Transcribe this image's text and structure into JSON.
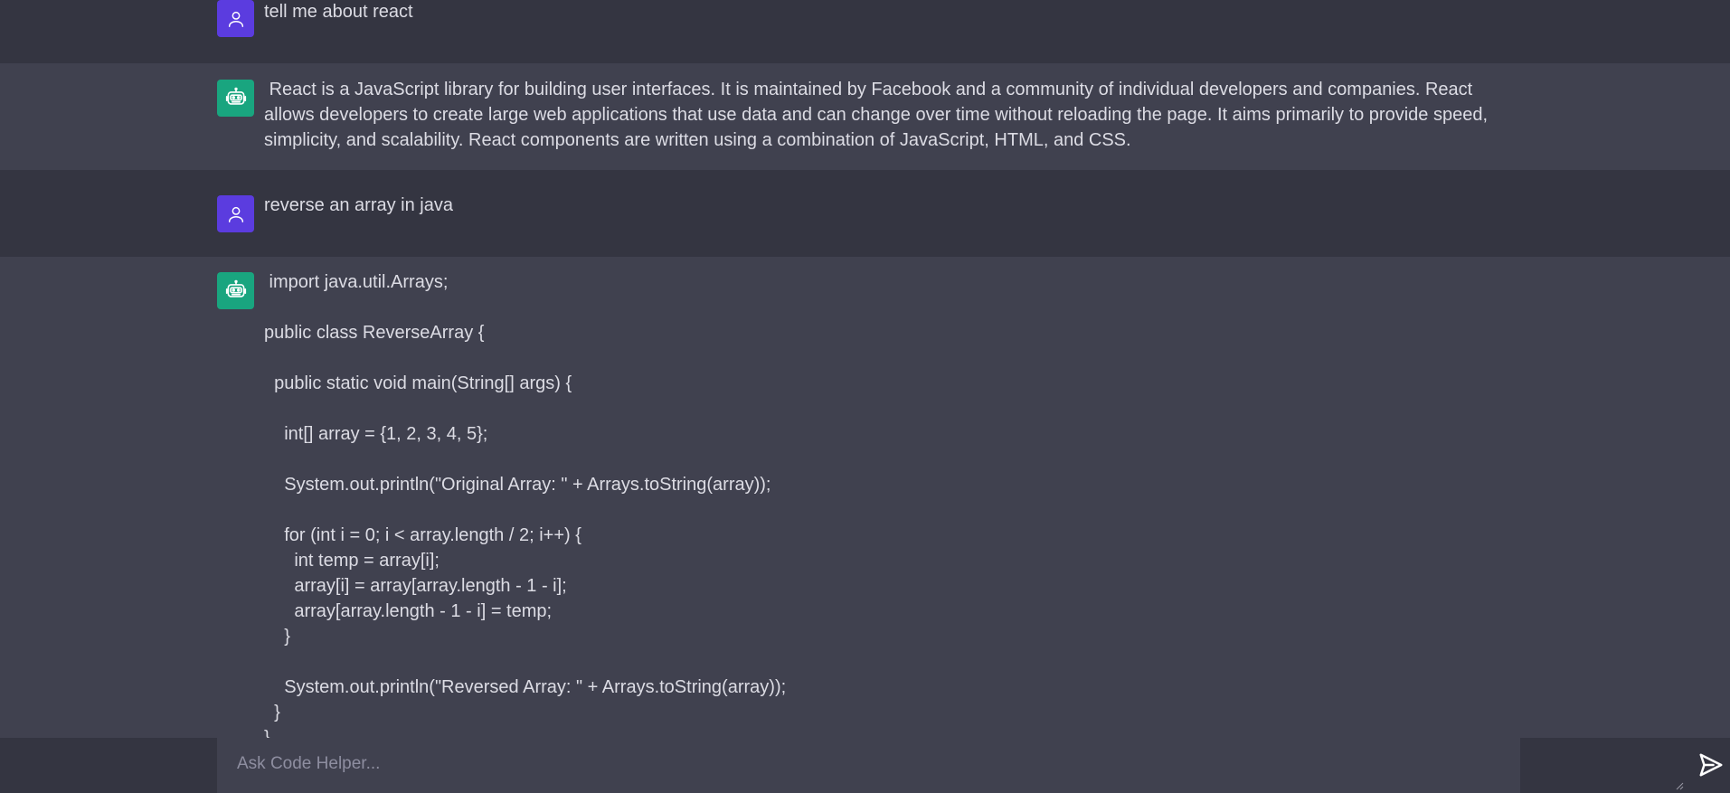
{
  "conversation": {
    "messages": [
      {
        "role": "user",
        "text": "tell me about react"
      },
      {
        "role": "bot",
        "text": " React is a JavaScript library for building user interfaces. It is maintained by Facebook and a community of individual developers and companies. React allows developers to create large web applications that use data and can change over time without reloading the page. It aims primarily to provide speed, simplicity, and scalability. React components are written using a combination of JavaScript, HTML, and CSS."
      },
      {
        "role": "user",
        "text": "reverse an array in java"
      },
      {
        "role": "bot",
        "text": " import java.util.Arrays;\n\npublic class ReverseArray {\n\n  public static void main(String[] args) {\n\n    int[] array = {1, 2, 3, 4, 5};\n\n    System.out.println(\"Original Array: \" + Arrays.toString(array));\n\n    for (int i = 0; i < array.length / 2; i++) {\n      int temp = array[i];\n      array[i] = array[array.length - 1 - i];\n      array[array.length - 1 - i] = temp;\n    }\n\n    System.out.println(\"Reversed Array: \" + Arrays.toString(array));\n  }\n}"
      }
    ]
  },
  "composer": {
    "placeholder": "Ask Code Helper...",
    "value": ""
  },
  "icons": {
    "user_avatar": "user-icon",
    "bot_avatar": "robot-icon",
    "send": "send-icon"
  },
  "colors": {
    "user_avatar_bg": "#5b3cdf",
    "bot_avatar_bg": "#19a57f",
    "user_row_bg": "#343541",
    "bot_row_bg": "#40414f"
  }
}
